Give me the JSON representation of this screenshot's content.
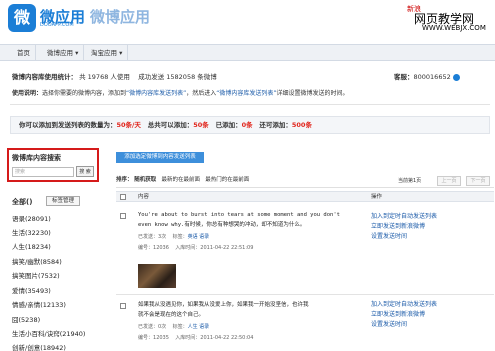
{
  "logo": {
    "mark": "微",
    "name": "微应用",
    "sub": "DOOAPP.COM",
    "product": "微博应用"
  },
  "watermark": {
    "sina": "新浪",
    "line1": "网页教学网",
    "line2": "WWW.WEBJX.COM"
  },
  "nav": {
    "home": "首页",
    "weibo_app": "微博应用",
    "taobao_app": "淘宝应用"
  },
  "stats": {
    "label": "微博内容库使用统计：",
    "users_prefix": "共",
    "users_count": "19768",
    "users_suffix": "人使用",
    "sent_prefix": "成功发送",
    "sent_count": "1582058",
    "sent_suffix": "条微博",
    "support_label": "客服：",
    "support_qq": "800016652"
  },
  "instructions": {
    "label": "使用说明：",
    "text1": "选择你需要的微博内容，添加到",
    "link1": "“微博内容库发送列表”",
    "text2": "，然后进入",
    "link2": "“微博内容库发送列表”",
    "text3": "详细设置微博发送的时间。"
  },
  "quota": {
    "daily_label": "你可以添加到发送列表的数量为：",
    "daily_value": "50条/天",
    "total_label": "总共可以添加：",
    "total_value": "50条",
    "added_label": "已添加：",
    "added_value": "0条",
    "remaining_label": "还可添加：",
    "remaining_value": "500条"
  },
  "search": {
    "title": "微博库内容搜索",
    "placeholder": "搜索",
    "button": "搜 索"
  },
  "add_button": "添加选定微博到内容发送列表",
  "tags": {
    "all_label": "全部()",
    "manage_button": "标签管理",
    "categories": [
      "语录(28091)",
      "生活(32230)",
      "人生(18234)",
      "搞笑/幽默(8584)",
      "搞笑图片(7532)",
      "爱情(35493)",
      "情感/亲情(12133)",
      "囧(5238)",
      "生活小百科/诀窍(21940)",
      "创新/创意(18942)"
    ]
  },
  "sort": {
    "label": "排序：",
    "options": [
      "随机获取",
      "最新的在最前面",
      "最热门的在最前面"
    ],
    "page_text": "当前第1页",
    "prev": "上一页",
    "next": "下一页"
  },
  "table_header": {
    "content": "内容",
    "actions": "操作"
  },
  "posts": [
    {
      "line1": "You're about to burst into tears at some moment and you don't",
      "line2": "even know why.有时候，你总有种想哭的冲动，却不知道为什么。",
      "sent_label": "已发送：",
      "sent_value": "3次",
      "tags_label": "标签：",
      "tags_value": "英语 语录",
      "id_label": "编号：",
      "id_value": "12036",
      "time_label": "入库时间：",
      "time_value": "2011-04-22 22:51:09"
    },
    {
      "line1": "如果我从没遇见你，如果我从没爱上你，如果我一开始没坚信，也许我",
      "line2": "就不会是现在的这个自己。",
      "sent_label": "已发送：",
      "sent_value": "0次",
      "tags_label": "标签：",
      "tags_value": "人生 语录",
      "id_label": "编号：",
      "id_value": "12035",
      "time_label": "入库时间：",
      "time_value": "2011-04-22 22:50:04"
    }
  ],
  "actions": [
    "加入到定时自动发送列表",
    "立即发送到新浪微博",
    "设置发送时间"
  ]
}
